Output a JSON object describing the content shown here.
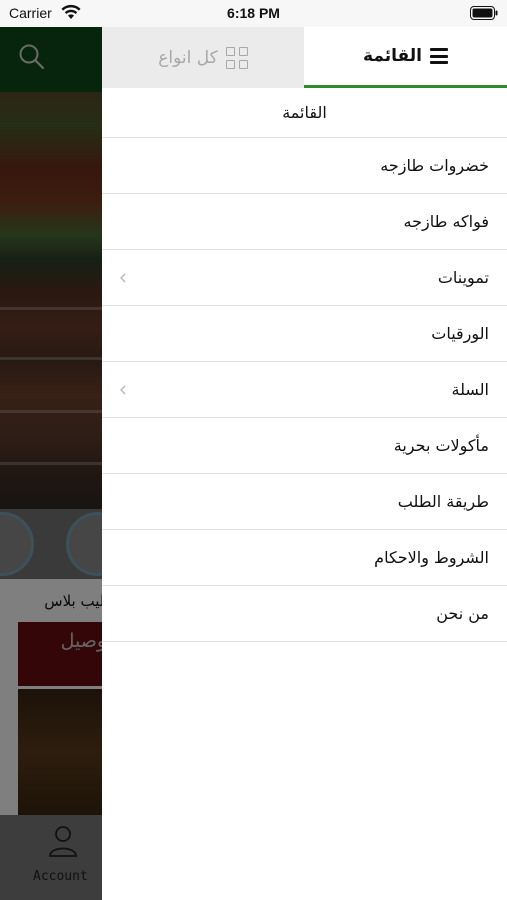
{
  "status_bar": {
    "carrier": "Carrier",
    "time": "6:18 PM"
  },
  "background": {
    "product_labels": "حليب  بلاس",
    "delivery_label": "توصيل",
    "account_label": "Account",
    "header_color": "#0f4a19"
  },
  "drawer": {
    "tabs": {
      "menu_label": "القائمة",
      "all_types_label": "كل انواع"
    },
    "accent_color": "#2e8b2e",
    "menu_title": "القائمة",
    "items": [
      {
        "label": "خضروات طازجه",
        "has_submenu": false
      },
      {
        "label": "فواكه طازجه",
        "has_submenu": false
      },
      {
        "label": "تموينات",
        "has_submenu": true
      },
      {
        "label": "الورقيات",
        "has_submenu": false
      },
      {
        "label": "السلة",
        "has_submenu": true
      },
      {
        "label": "مأكولات بحرية",
        "has_submenu": false
      },
      {
        "label": "طريقة الطلب",
        "has_submenu": false
      },
      {
        "label": "الشروط والاحكام",
        "has_submenu": false
      },
      {
        "label": "من نحن",
        "has_submenu": false
      }
    ]
  },
  "icons": [
    "wifi-icon",
    "battery-icon",
    "search-icon",
    "account-icon",
    "hamburger-icon",
    "grid-icon",
    "chevron-left-icon"
  ]
}
